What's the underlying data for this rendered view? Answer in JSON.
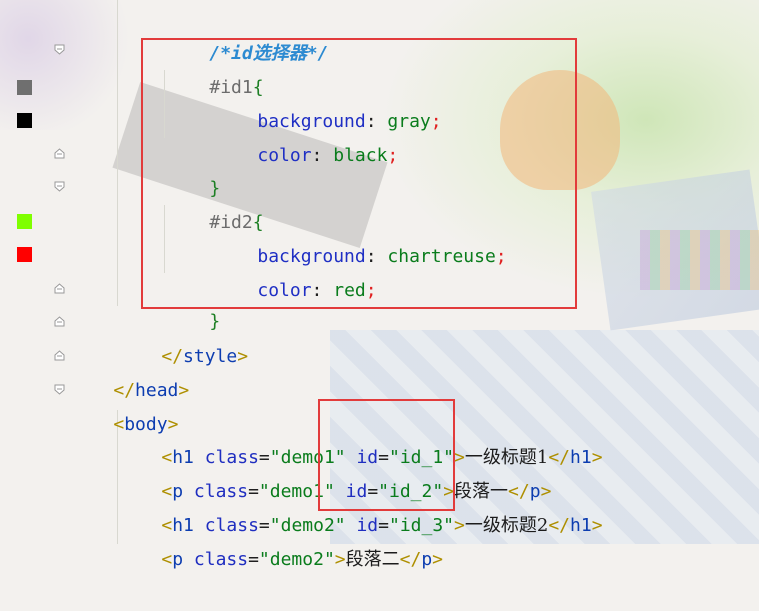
{
  "editor": {
    "gutter": {
      "swatches": [
        {
          "name": "gray-color-swatch",
          "color": "#6f6f6f"
        },
        {
          "name": "black-color-swatch",
          "color": "#000000"
        },
        {
          "name": "chartreuse-color-swatch",
          "color": "#7fff00"
        },
        {
          "name": "red-color-swatch",
          "color": "#ff0000"
        }
      ]
    },
    "lines": [
      {
        "comment": "/*id选择器*/"
      },
      {
        "selector": "#id1",
        "brace": "{"
      },
      {
        "prop": "background",
        "colon": ":",
        "value": "gray",
        "semi": ";"
      },
      {
        "prop": "color",
        "colon": ":",
        "value": "black",
        "semi": ";"
      },
      {
        "brace": "}"
      },
      {
        "selector": "#id2",
        "brace": "{"
      },
      {
        "prop": "background",
        "colon": ":",
        "value": "chartreuse",
        "semi": ";"
      },
      {
        "prop": "color",
        "colon": ":",
        "value": "red",
        "semi": ";"
      },
      {
        "brace": "}"
      },
      {
        "open": "</",
        "tag": "style",
        "close": ">"
      },
      {
        "open": "</",
        "tag": "head",
        "close": ">"
      },
      {
        "open": "<",
        "tag": "body",
        "close": ">"
      },
      {
        "open": "<",
        "tag": "h1",
        "a1": "class",
        "eq1": "=",
        "v1": "\"demo1\"",
        "a2": "id",
        "eq2": "=",
        "v2": "\"id_1\"",
        "close": ">",
        "text": "一级标题1",
        "etag_open": "</",
        "etag": "h1",
        "etag_close": ">"
      },
      {
        "open": "<",
        "tag": "p",
        "a1": "class",
        "eq1": "=",
        "v1": "\"demo1\"",
        "a2": "id",
        "eq2": "=",
        "v2": "\"id_2\"",
        "close": ">",
        "text": "段落一",
        "etag_open": "</",
        "etag": "p",
        "etag_close": ">"
      },
      {
        "open": "<",
        "tag": "h1",
        "a1": "class",
        "eq1": "=",
        "v1": "\"demo2\"",
        "a2": "id",
        "eq2": "=",
        "v2": "\"id_3\"",
        "close": ">",
        "text": "一级标题2",
        "etag_open": "</",
        "etag": "h1",
        "etag_close": ">"
      },
      {
        "open": "<",
        "tag": "p",
        "a1": "class",
        "eq1": "=",
        "v1": "\"demo2\"",
        "close": ">",
        "text": "段落二",
        "etag_open": "</",
        "etag": "p",
        "etag_close": ">"
      }
    ]
  }
}
